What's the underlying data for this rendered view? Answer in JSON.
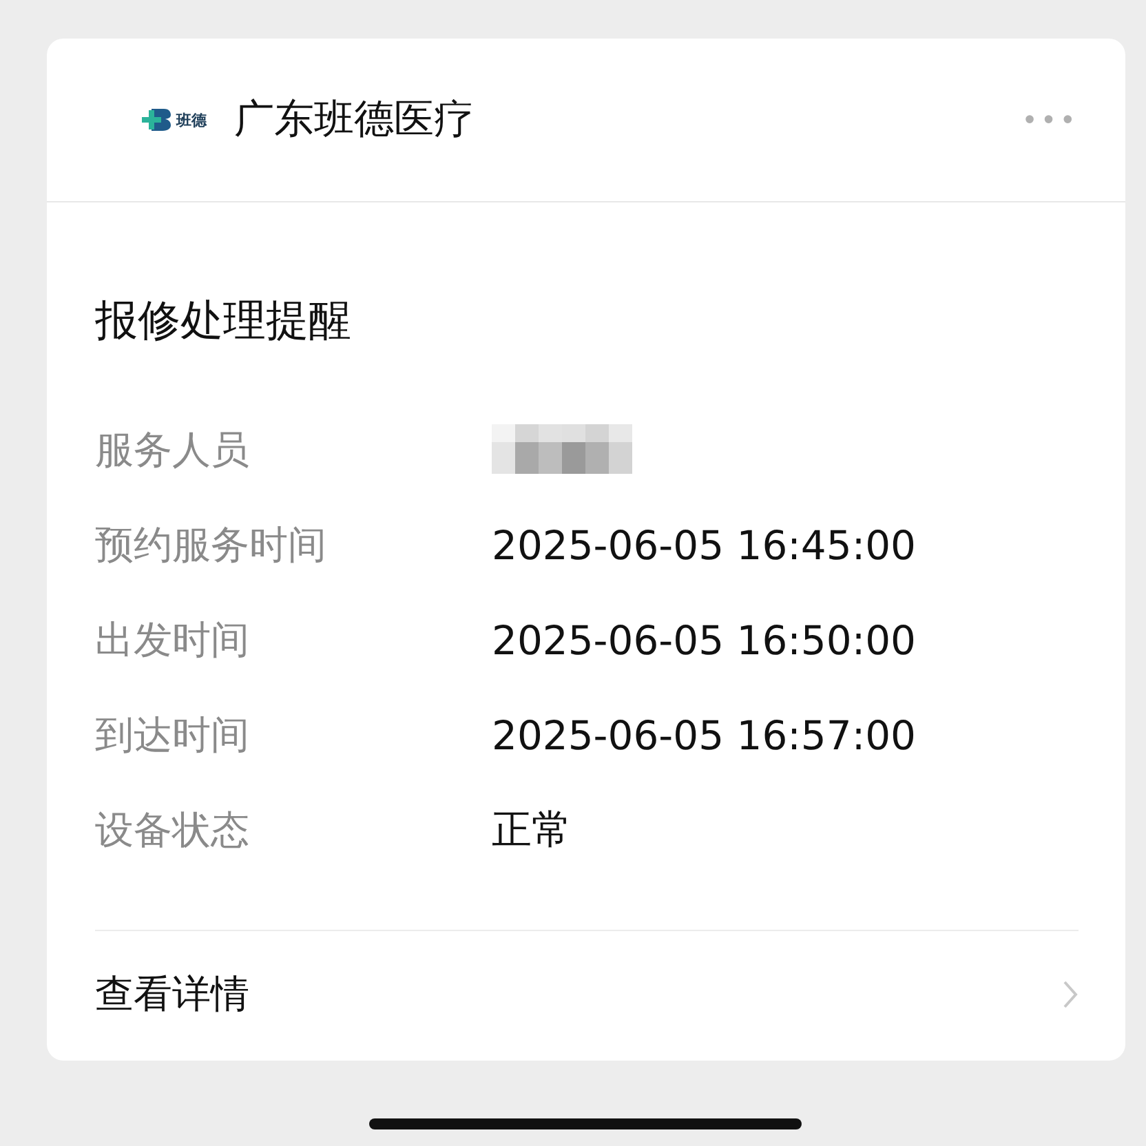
{
  "header": {
    "logo_text": "班德",
    "account_name": "广东班德医疗",
    "menu_icon": "•••"
  },
  "title": "报修处理提醒",
  "fields": [
    {
      "label": "服务人员",
      "kind": "redacted"
    },
    {
      "label": "预约服务时间",
      "kind": "text",
      "value": "2025-06-05 16:45:00"
    },
    {
      "label": "出发时间",
      "kind": "text",
      "value": "2025-06-05 16:50:00"
    },
    {
      "label": "到达时间",
      "kind": "text",
      "value": "2025-06-05 16:57:00"
    },
    {
      "label": "设备状态",
      "kind": "text",
      "value": "正常"
    }
  ],
  "footer": {
    "link": "查看详情"
  }
}
